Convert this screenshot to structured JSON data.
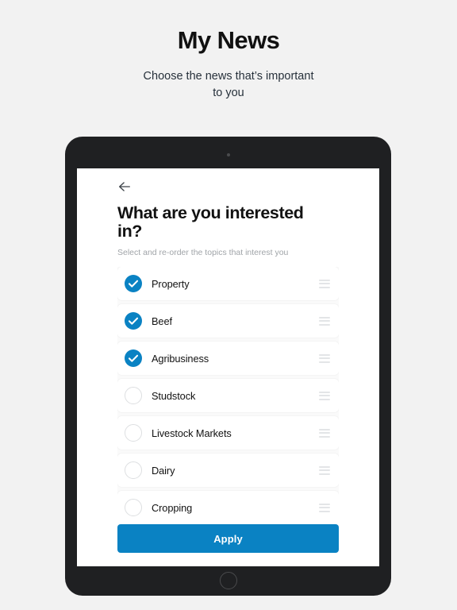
{
  "page": {
    "title": "My News",
    "subtitle": "Choose the news that’s important to you",
    "background_color": "#f2f2f2"
  },
  "device": {
    "frame_color": "#1f2022",
    "camera_icon": "camera-dot",
    "home_icon": "home-button-circle"
  },
  "app": {
    "back_icon": "back-arrow-icon",
    "heading": "What are you interested in?",
    "subheading": "Select and re-order the topics that interest you",
    "accent_color": "#0a82c3",
    "topics": [
      {
        "label": "Property",
        "selected": true,
        "handle_icon": "drag-handle-icon"
      },
      {
        "label": "Beef",
        "selected": true,
        "handle_icon": "drag-handle-icon"
      },
      {
        "label": "Agribusiness",
        "selected": true,
        "handle_icon": "drag-handle-icon"
      },
      {
        "label": "Studstock",
        "selected": false,
        "handle_icon": "drag-handle-icon"
      },
      {
        "label": "Livestock Markets",
        "selected": false,
        "handle_icon": "drag-handle-icon"
      },
      {
        "label": "Dairy",
        "selected": false,
        "handle_icon": "drag-handle-icon"
      },
      {
        "label": "Cropping",
        "selected": false,
        "handle_icon": "drag-handle-icon"
      }
    ],
    "apply_label": "Apply"
  }
}
